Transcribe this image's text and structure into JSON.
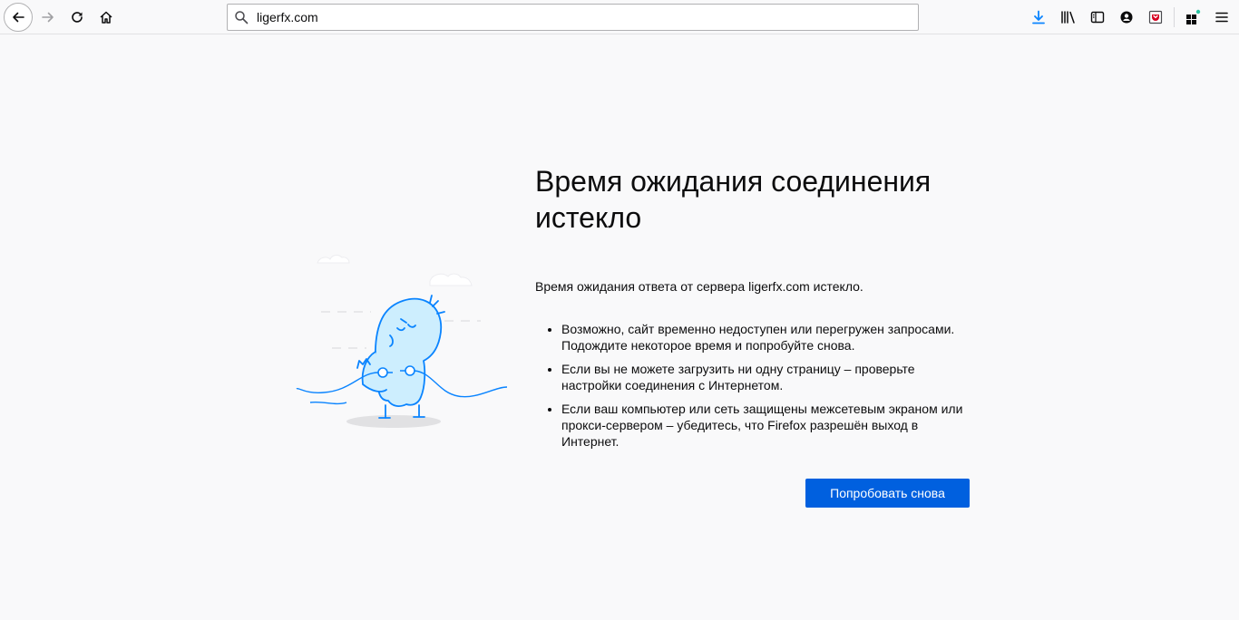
{
  "toolbar": {
    "url": "ligerfx.com",
    "icons": [
      "back-icon",
      "forward-icon",
      "reload-icon",
      "home-icon",
      "search-icon",
      "download-icon",
      "library-icon",
      "sidebar-icon",
      "account-icon",
      "pocket-icon",
      "extensions-icon",
      "menu-icon"
    ],
    "accent": "#0a84ff"
  },
  "error": {
    "title": "Время ожидания соединения истекло",
    "lead": "Время ожидания ответа от сервера ligerfx.com истекло.",
    "bullets": [
      "Возможно, сайт временно недоступен или перегружен запросами. Подождите некоторое время и попробуйте снова.",
      "Если вы не можете загрузить ни одну страницу – проверьте настройки соединения с Интернетом.",
      "Если ваш компьютер или сеть защищены межсетевым экраном или прокси-сервером – убедитесь, что Firefox разрешён выход в Интернет."
    ],
    "retry_label": "Попробовать снова",
    "button_color": "#0060df"
  }
}
